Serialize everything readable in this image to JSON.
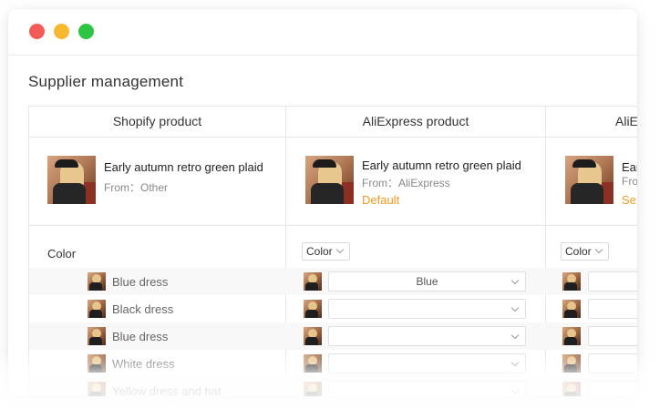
{
  "page": {
    "title": "Supplier management"
  },
  "columns": [
    {
      "header": "Shopify product",
      "product_name": "Early autumn retro green plaid",
      "from": "From：Other",
      "badge": ""
    },
    {
      "header": "AliExpress product",
      "product_name": "Early autumn retro green plaid",
      "from": "From：AliExpress",
      "badge": "Default"
    },
    {
      "header": "AliE",
      "product_name": "Ear",
      "from": "Fro",
      "badge": "Se"
    }
  ],
  "attribute": {
    "label": "Color",
    "mapping_select_value": "Color"
  },
  "variants": [
    {
      "label": "Blue dress",
      "mapped_value": "Blue"
    },
    {
      "label": "Black dress",
      "mapped_value": ""
    },
    {
      "label": "Blue dress",
      "mapped_value": ""
    },
    {
      "label": "White dress",
      "mapped_value": ""
    },
    {
      "label": "Yellow dress and hat",
      "mapped_value": ""
    }
  ],
  "colors": {
    "accent": "#f29a1f",
    "close": "#f25b57",
    "minimize": "#f7b731",
    "maximize": "#2fc544"
  }
}
